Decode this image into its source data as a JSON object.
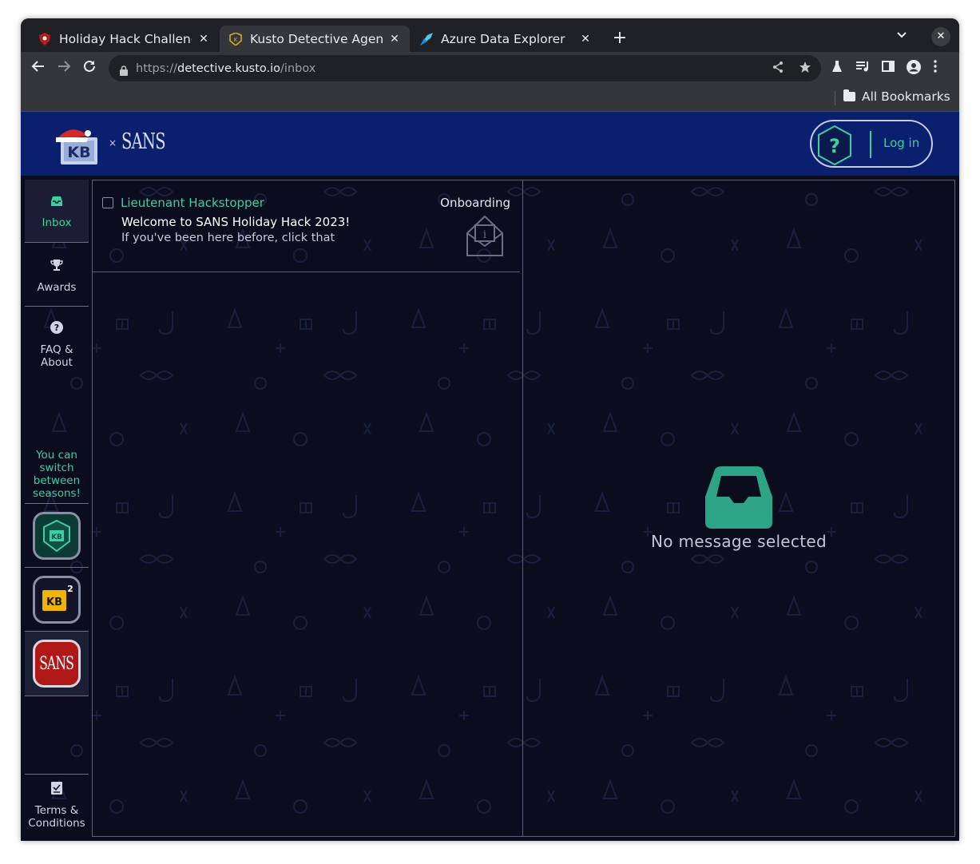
{
  "browser": {
    "tabs": [
      {
        "title": "Holiday Hack Challenge",
        "active": false,
        "favicon": "shield-favicon"
      },
      {
        "title": "Kusto Detective Agency",
        "active": true,
        "favicon": "kusto-badge-favicon"
      },
      {
        "title": "Azure Data Explorer",
        "active": false,
        "favicon": "azure-data-explorer-favicon"
      }
    ],
    "url_scheme": "https://",
    "url_host": "detective.kusto.io",
    "url_path": "/inbox",
    "bookmarks_label": "All Bookmarks"
  },
  "header": {
    "logo_x": "×",
    "partner_logo": "SANS",
    "help_symbol": "?",
    "login_label": "Log in"
  },
  "sidebar": {
    "items": [
      {
        "label": "Inbox",
        "icon": "inbox-icon",
        "active": true
      },
      {
        "label": "Awards",
        "icon": "trophy-icon",
        "active": false
      },
      {
        "label_line1": "FAQ &",
        "label_line2": "About",
        "icon": "help-circle-icon",
        "active": false
      }
    ],
    "season_note": [
      "You can",
      "switch",
      "between",
      "seasons!"
    ],
    "seasons": [
      {
        "name": "season-1",
        "active": false
      },
      {
        "name": "season-2",
        "badge": "2",
        "active": false
      },
      {
        "name": "SANS",
        "label": "SANS",
        "active": true
      }
    ],
    "terms_line1": "Terms &",
    "terms_line2": "Conditions"
  },
  "inbox": {
    "messages": [
      {
        "sender": "Lieutenant Hackstopper",
        "folder": "Onboarding",
        "subject": "Welcome to SANS Holiday Hack 2023!",
        "preview": "If you've been here before, click that",
        "checked": false
      }
    ]
  },
  "message_view": {
    "empty_text": "No message selected"
  },
  "colors": {
    "accent": "#3ecf9f",
    "header_bg": "#0a1f6e",
    "page_bg": "#0b0d1f"
  }
}
